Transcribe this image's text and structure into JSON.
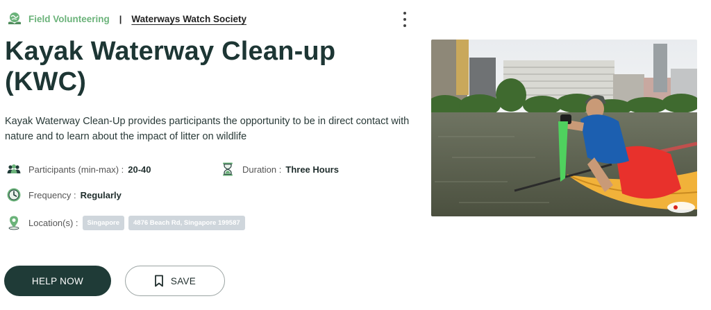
{
  "header": {
    "category": "Field Volunteering",
    "separator": "|",
    "organization": "Waterways Watch Society"
  },
  "event": {
    "title": "Kayak Waterway Clean-up (KWC)",
    "description": "Kayak Waterway Clean-Up provides participants the opportunity to be in direct contact with nature and to learn about the impact of litter on wildlife"
  },
  "details": {
    "participants_label": "Participants (min-max) :",
    "participants_value": "20-40",
    "duration_label": "Duration :",
    "duration_value": "Three Hours",
    "frequency_label": "Frequency :",
    "frequency_value": "Regularly",
    "location_label": "Location(s) :",
    "locations": [
      "Singapore",
      "4876 Beach Rd, Singapore 199587"
    ]
  },
  "actions": {
    "help_label": "HELP NOW",
    "save_label": "SAVE"
  },
  "colors": {
    "primary": "#1f3b37",
    "accent_green": "#6bb37a",
    "chip_bg": "#cfd6dc"
  },
  "icons": {
    "category": "globe-hands-icon",
    "participants": "people-icon",
    "duration": "hourglass-icon",
    "frequency": "clock-icon",
    "location": "map-pin-icon",
    "menu": "kebab-menu-icon",
    "save": "bookmark-icon"
  }
}
